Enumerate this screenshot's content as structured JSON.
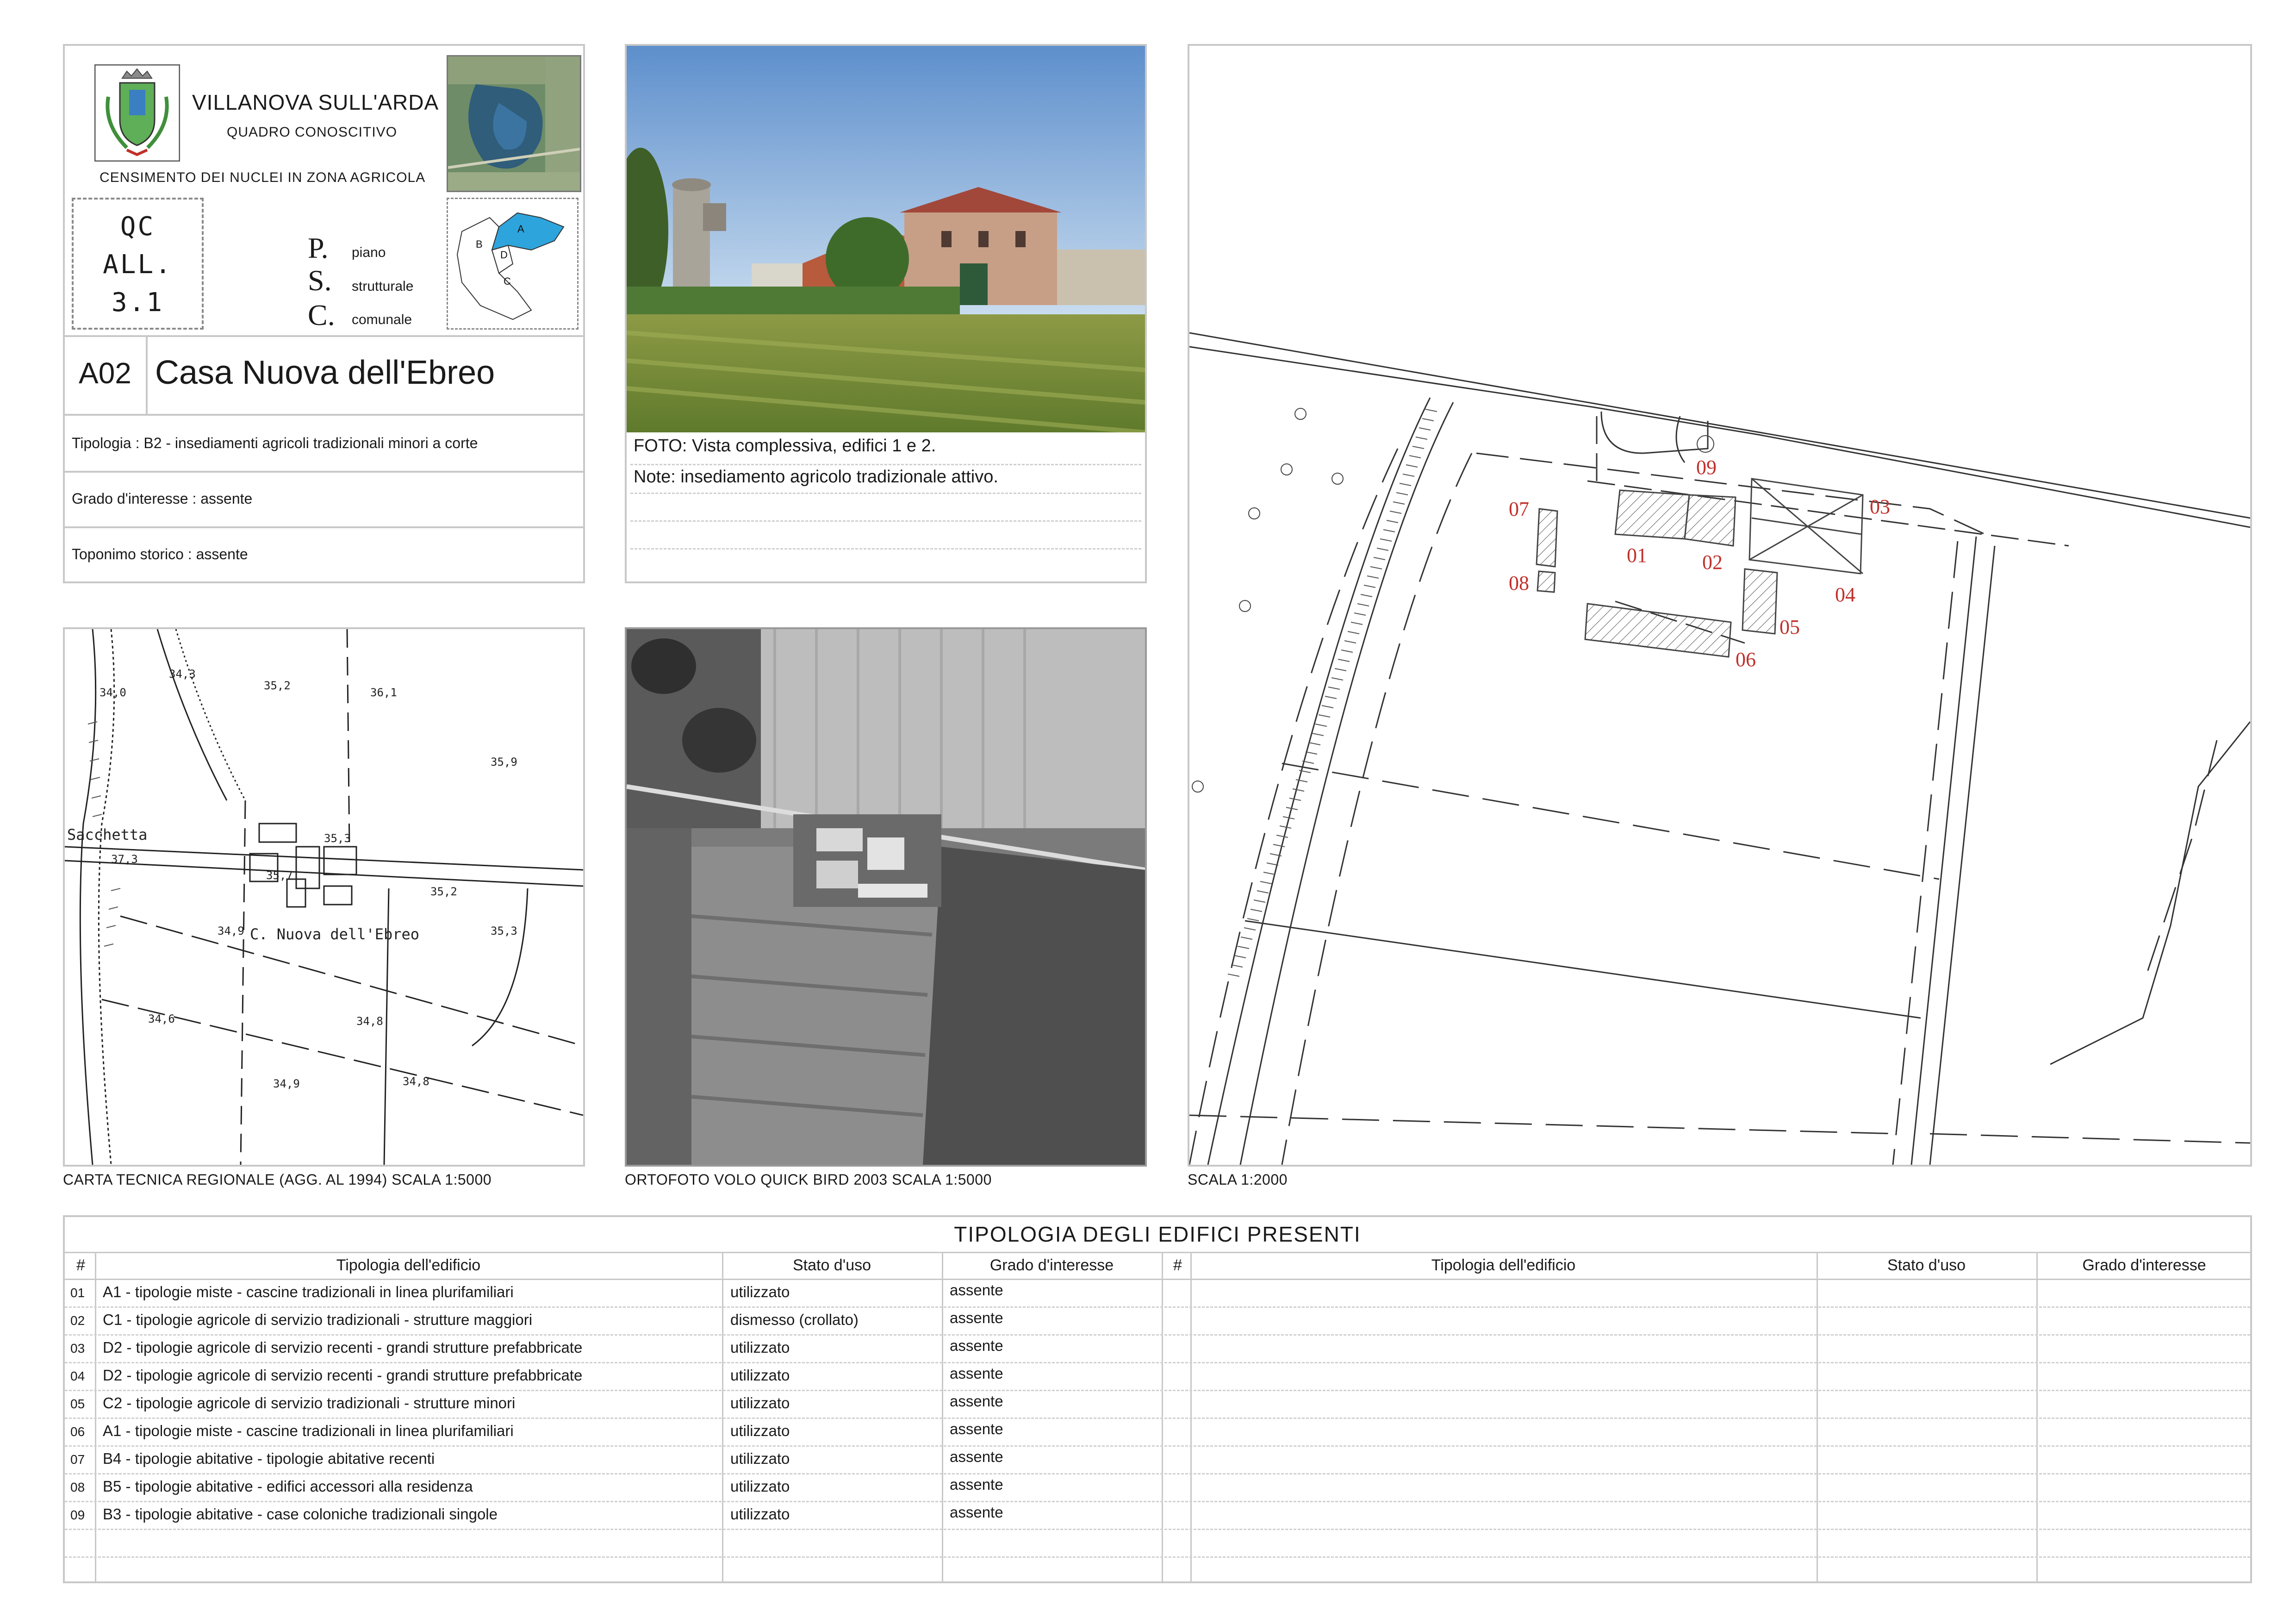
{
  "header": {
    "municipality": "VILLANOVA SULL'ARDA",
    "subtitle": "QUADRO CONOSCITIVO",
    "census": "CENSIMENTO DEI NUCLEI IN ZONA AGRICOLA",
    "qc_lines": [
      "QC",
      "ALL.",
      "3.1"
    ],
    "psc": {
      "letters": [
        "P.",
        "S.",
        "C."
      ],
      "words": [
        "piano",
        "strutturale",
        "comunale"
      ]
    },
    "zones": [
      "A",
      "B",
      "C",
      "D"
    ]
  },
  "site": {
    "code": "A02",
    "name": "Casa Nuova dell'Ebreo",
    "rows": [
      "Tipologia : B2 - insediamenti agricoli tradizionali minori a corte",
      "Grado d'interesse : assente",
      "Toponimo storico : assente"
    ]
  },
  "photo": {
    "caption": "FOTO: Vista complessiva,  edifici 1 e 2.",
    "note": "Note: insediamento agricolo tradizionale attivo."
  },
  "maps": {
    "ctr_caption": "CARTA TECNICA REGIONALE (AGG. AL 1994) SCALA 1:5000",
    "orto_caption": "ORTOFOTO VOLO QUICK BIRD 2003 SCALA 1:5000",
    "plan_caption": "SCALA 1:2000",
    "ctr_labels": {
      "place": "Sacchetta",
      "farm": "C. Nuova dell'Ebreo",
      "elevations": [
        "34,3",
        "35,2",
        "36,1",
        "34,0",
        "35,9",
        "35,7",
        "35,3",
        "35,2",
        "34,9",
        "35,3",
        "34,6",
        "34,8",
        "34,9",
        "34,8",
        "37,3"
      ]
    },
    "plan_labels": [
      "09",
      "07",
      "01",
      "02",
      "03",
      "08",
      "04",
      "05",
      "06"
    ],
    "label_color": "#c0302a"
  },
  "table": {
    "title": "TIPOLOGIA DEGLI EDIFICI PRESENTI",
    "headers": {
      "num": "#",
      "type": "Tipologia dell'edificio",
      "status": "Stato d'uso",
      "grade": "Grado d'interesse"
    },
    "rows": [
      {
        "num": "01",
        "type": "A1 - tipologie miste - cascine tradizionali in linea plurifamiliari",
        "status": "utilizzato",
        "grade": "assente"
      },
      {
        "num": "02",
        "type": "C1 - tipologie agricole di servizio tradizionali - strutture maggiori",
        "status": "dismesso (crollato)",
        "grade": "assente"
      },
      {
        "num": "03",
        "type": "D2 - tipologie agricole di servizio recenti - grandi strutture prefabbricate",
        "status": "utilizzato",
        "grade": "assente"
      },
      {
        "num": "04",
        "type": "D2 - tipologie agricole di servizio recenti - grandi strutture prefabbricate",
        "status": "utilizzato",
        "grade": "assente"
      },
      {
        "num": "05",
        "type": "C2 - tipologie agricole di servizio tradizionali - strutture minori",
        "status": "utilizzato",
        "grade": "assente"
      },
      {
        "num": "06",
        "type": "A1 - tipologie miste - cascine tradizionali in linea plurifamiliari",
        "status": "utilizzato",
        "grade": "assente"
      },
      {
        "num": "07",
        "type": "B4 - tipologie abitative - tipologie abitative recenti",
        "status": "utilizzato",
        "grade": "assente"
      },
      {
        "num": "08",
        "type": "B5 - tipologie abitative - edifici accessori alla residenza",
        "status": "utilizzato",
        "grade": "assente"
      },
      {
        "num": "09",
        "type": "B3 - tipologie abitative - case coloniche tradizionali singole",
        "status": "utilizzato",
        "grade": "assente"
      }
    ]
  }
}
